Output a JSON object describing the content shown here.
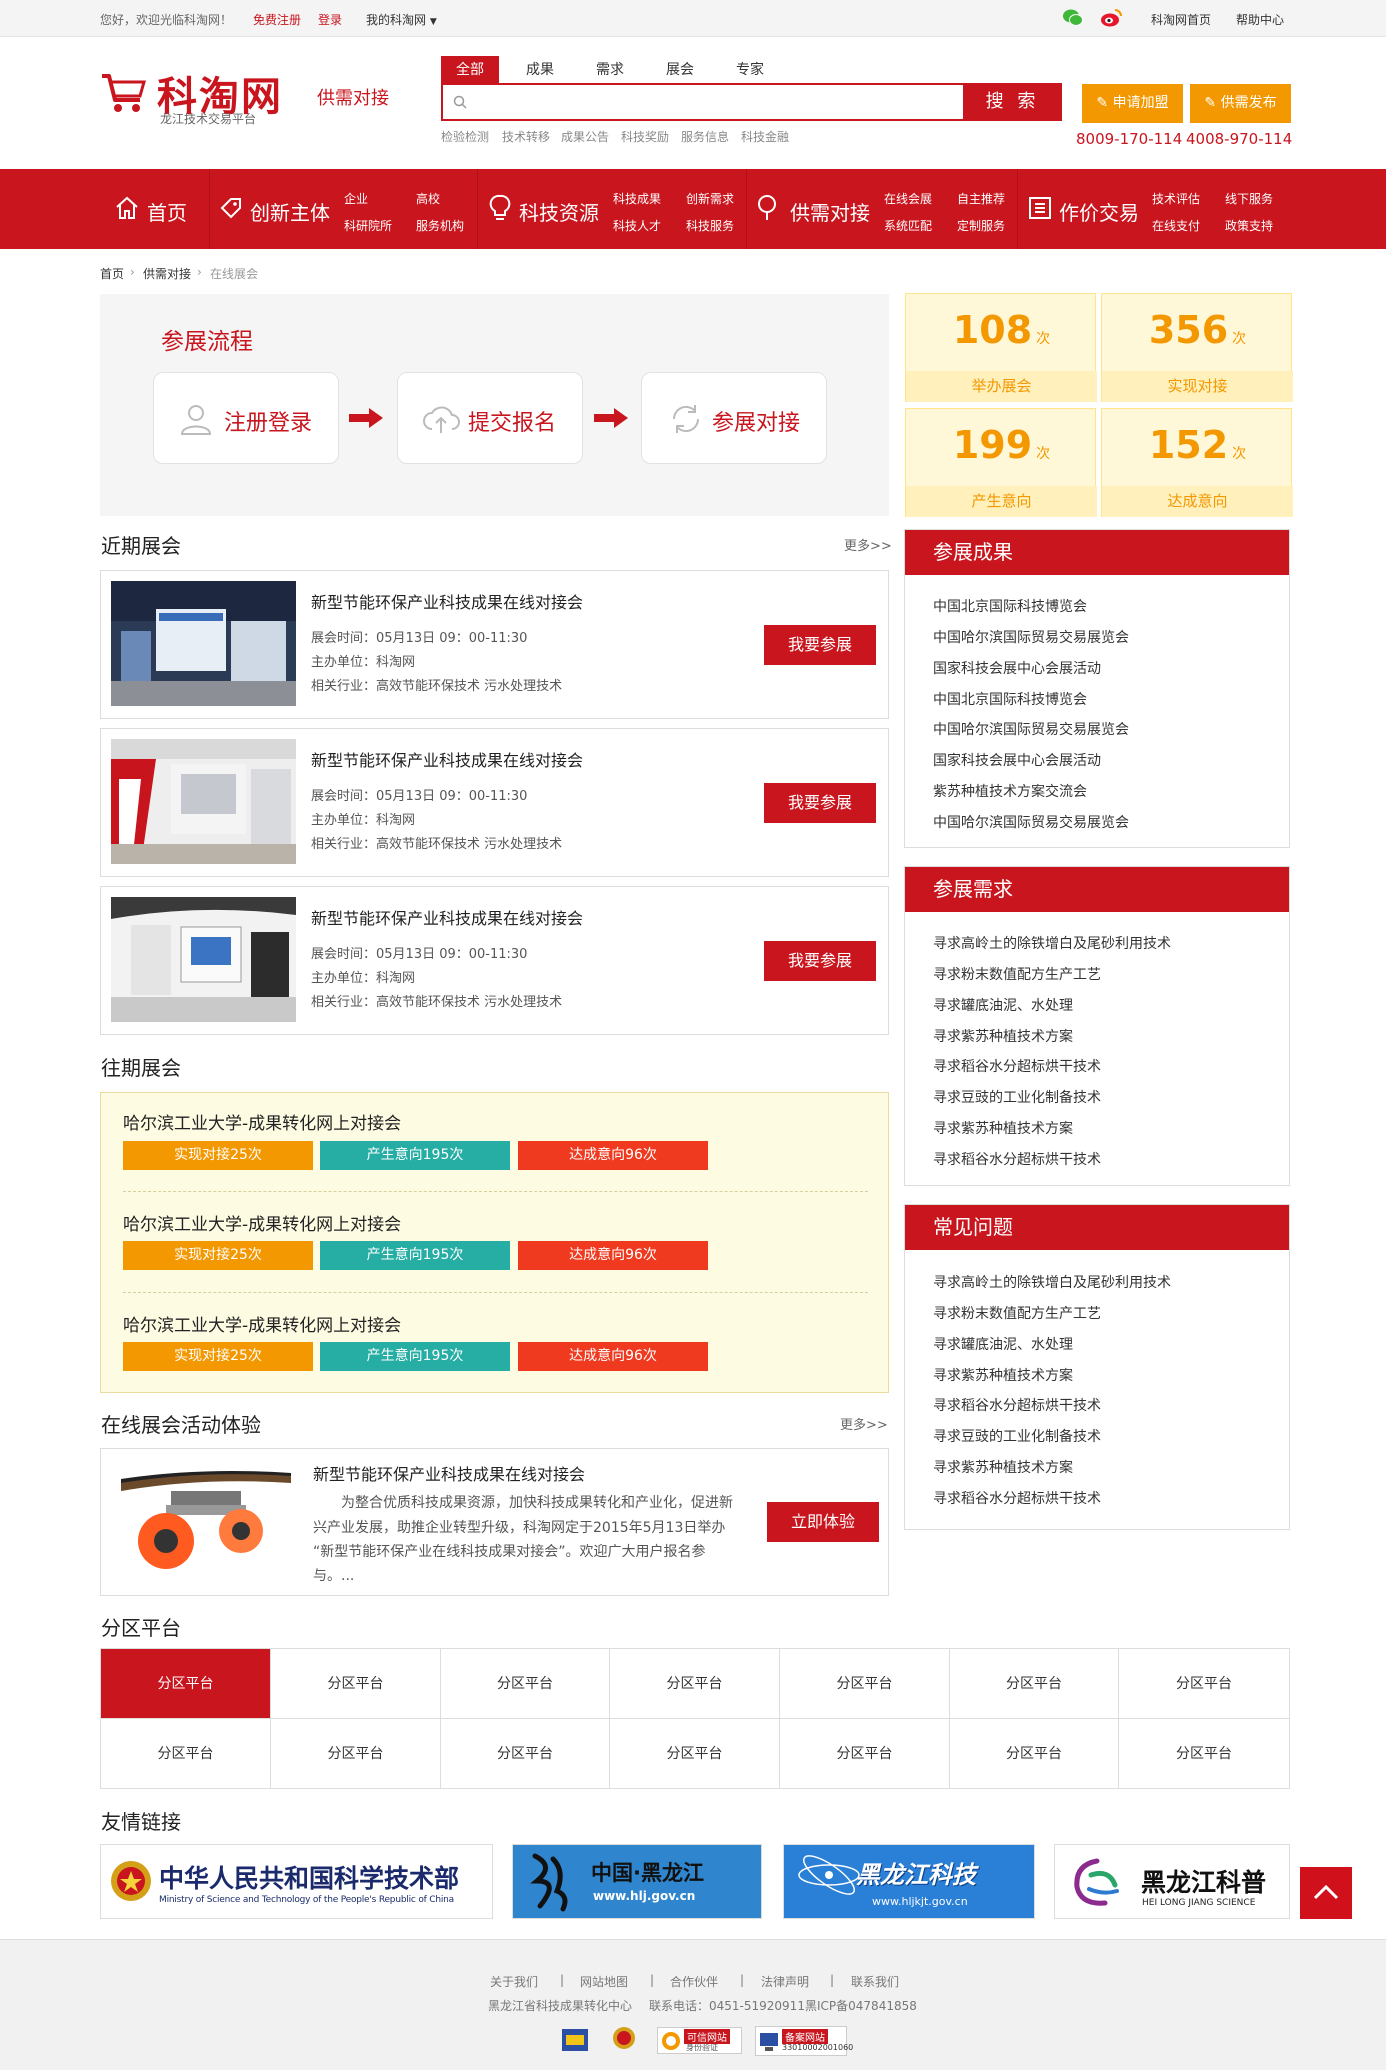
{
  "topbar": {
    "welcome": "您好，欢迎光临科淘网！",
    "register": "免费注册",
    "login": "登录",
    "my": "我的科淘网",
    "home": "科淘网首页",
    "help": "帮助中心"
  },
  "header": {
    "logo": "科淘网",
    "logo_sub": "龙江技术交易平台",
    "tagline": "供需对接",
    "search_tabs": [
      "全部",
      "成果",
      "需求",
      "展会",
      "专家"
    ],
    "search_placeholder": "",
    "search_button": "搜 索",
    "hot_words": [
      "检验检测",
      "技术转移",
      "成果公告",
      "科技奖励",
      "服务信息",
      "科技金融"
    ],
    "btn_join": "申请加盟",
    "btn_publish": "供需发布",
    "phone1": "8009-170-114",
    "phone2": "4008-970-114"
  },
  "nav": {
    "home": "首页",
    "g1": {
      "title": "创新主体",
      "links": [
        "企业",
        "高校",
        "科研院所",
        "服务机构"
      ]
    },
    "g2": {
      "title": "科技资源",
      "links": [
        "科技成果",
        "创新需求",
        "科技人才",
        "科技服务"
      ]
    },
    "g3": {
      "title": "供需对接",
      "links": [
        "在线会展",
        "自主推荐",
        "系统匹配",
        "定制服务"
      ]
    },
    "g4": {
      "title": "作价交易",
      "links": [
        "技术评估",
        "线下服务",
        "在线支付",
        "政策支持"
      ]
    }
  },
  "breadcrumb": {
    "a": "首页",
    "b": "供需对接",
    "c": "在线展会"
  },
  "process": {
    "title": "参展流程",
    "steps": [
      "注册登录",
      "提交报名",
      "参展对接"
    ]
  },
  "stats": [
    {
      "num": "108",
      "unit": "次",
      "label": "举办展会"
    },
    {
      "num": "356",
      "unit": "次",
      "label": "实现对接"
    },
    {
      "num": "199",
      "unit": "次",
      "label": "产生意向"
    },
    {
      "num": "152",
      "unit": "次",
      "label": "达成意向"
    }
  ],
  "recent": {
    "title": "近期展会",
    "more": "更多>>",
    "items": [
      {
        "title": "新型节能环保产业科技成果在线对接会",
        "time": "展会时间：05月13日 09：00-11:30",
        "host": "主办单位：科淘网",
        "industry": "相关行业：高效节能环保技术 污水处理技术",
        "btn": "我要参展"
      },
      {
        "title": "新型节能环保产业科技成果在线对接会",
        "time": "展会时间：05月13日 09：00-11:30",
        "host": "主办单位：科淘网",
        "industry": "相关行业：高效节能环保技术 污水处理技术",
        "btn": "我要参展"
      },
      {
        "title": "新型节能环保产业科技成果在线对接会",
        "time": "展会时间：05月13日 09：00-11:30",
        "host": "主办单位：科淘网",
        "industry": "相关行业：高效节能环保技术 污水处理技术",
        "btn": "我要参展"
      }
    ]
  },
  "past": {
    "title": "往期展会",
    "items": [
      {
        "title": "哈尔滨工业大学-成果转化网上对接会",
        "t1": "实现对接25次",
        "t2": "产生意向195次",
        "t3": "达成意向96次"
      },
      {
        "title": "哈尔滨工业大学-成果转化网上对接会",
        "t1": "实现对接25次",
        "t2": "产生意向195次",
        "t3": "达成意向96次"
      },
      {
        "title": "哈尔滨工业大学-成果转化网上对接会",
        "t1": "实现对接25次",
        "t2": "产生意向195次",
        "t3": "达成意向96次"
      }
    ]
  },
  "experience": {
    "title": "在线展会活动体验",
    "more": "更多>>",
    "item_title": "新型节能环保产业科技成果在线对接会",
    "desc1": "为整合优质科技成果资源，加快科技成果转化和产业化，促进新",
    "desc2": "兴产业发展，助推企业转型升级，科淘网定于2015年5月13日举办",
    "desc3": "“新型节能环保产业在线科技成果对接会”。欢迎广大用户报名参",
    "desc4": "与。...",
    "btn": "立即体验"
  },
  "side1": {
    "title": "参展成果",
    "items": [
      "中国北京国际科技博览会",
      "中国哈尔滨国际贸易交易展览会",
      "国家科技会展中心会展活动",
      "中国北京国际科技博览会",
      "中国哈尔滨国际贸易交易展览会",
      "国家科技会展中心会展活动",
      "紫苏种植技术方案交流会",
      "中国哈尔滨国际贸易交易展览会"
    ]
  },
  "side2": {
    "title": "参展需求",
    "items": [
      "寻求高岭土的除铁增白及尾砂利用技术",
      "寻求粉末数值配方生产工艺",
      "寻求罐底油泥、水处理",
      "寻求紫苏种植技术方案",
      "寻求稻谷水分超标烘干技术",
      "寻求豆豉的工业化制备技术",
      "寻求紫苏种植技术方案",
      "寻求稻谷水分超标烘干技术"
    ]
  },
  "side3": {
    "title": "常见问题",
    "items": [
      "寻求高岭土的除铁增白及尾砂利用技术",
      "寻求粉末数值配方生产工艺",
      "寻求罐底油泥、水处理",
      "寻求紫苏种植技术方案",
      "寻求稻谷水分超标烘干技术",
      "寻求豆豉的工业化制备技术",
      "寻求紫苏种植技术方案",
      "寻求稻谷水分超标烘干技术"
    ]
  },
  "partition": {
    "title": "分区平台",
    "cells": [
      "分区平台",
      "分区平台",
      "分区平台",
      "分区平台",
      "分区平台",
      "分区平台",
      "分区平台",
      "分区平台",
      "分区平台",
      "分区平台",
      "分区平台",
      "分区平台",
      "分区平台",
      "分区平台"
    ]
  },
  "links": {
    "title": "友情链接",
    "most_cn": "中华人民共和国科学技术部",
    "most_en": "Ministry of Science and Technology of the People's Republic of China",
    "hlj_cn": "中国·黑龙江",
    "hlj_url": "www.hlj.gov.cn",
    "kj_cn": "黑龙江科技",
    "kj_url": "www.hljkjt.gov.cn",
    "kp_cn": "黑龙江科普",
    "kp_en": "HEI LONG JIANG SCIENCE"
  },
  "footer": {
    "links": [
      "关于我们",
      "网站地图",
      "合作伙伴",
      "法律声明",
      "联系我们"
    ],
    "org": "黑龙江省科技成果转化中心",
    "tel": "联系电话：0451-51920911",
    "icp": "黑ICP备047841858",
    "badge1": "可信网站",
    "badge1_sub": "身份验证",
    "badge2": "备案网站",
    "badge2_sub": "33010002001060"
  },
  "colors": {
    "brand": "#c9151e",
    "orange": "#f39800",
    "teal": "#26ada4",
    "redtag": "#ef3a1f"
  }
}
